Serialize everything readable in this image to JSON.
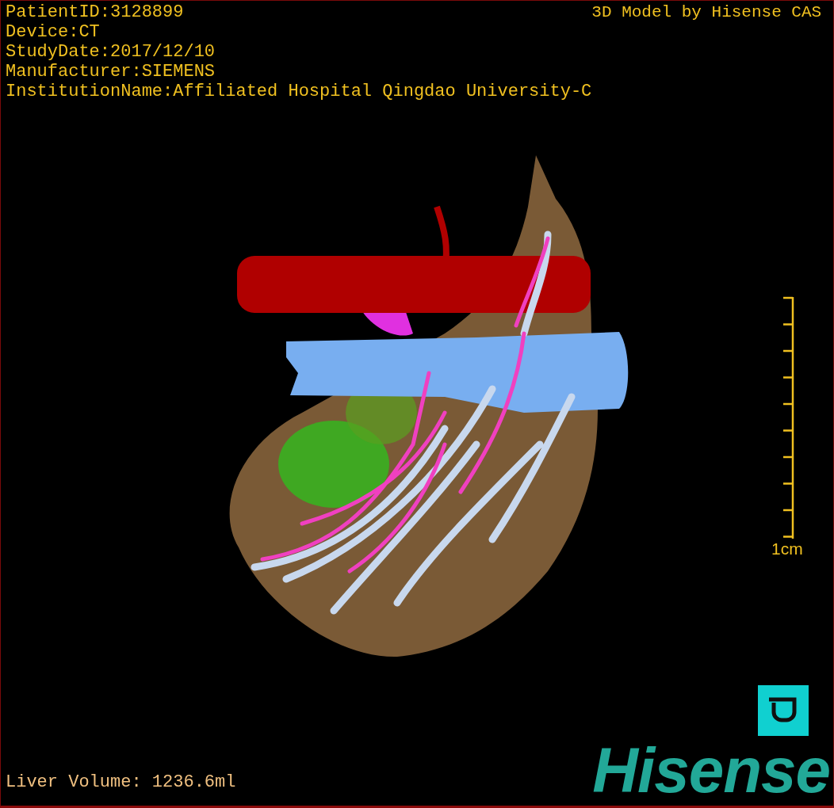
{
  "info_lines": [
    "PatientID:3128899",
    "Device:CT",
    "StudyDate:2017/12/10",
    "Manufacturer:SIEMENS",
    "InstitutionName:Affiliated Hospital Qingdao University-C"
  ],
  "model_credit": "3D Model by Hisense CAS",
  "scale": {
    "label": "1cm"
  },
  "liver_volume": "Liver Volume: 1236.6ml",
  "logo": "Hisense"
}
